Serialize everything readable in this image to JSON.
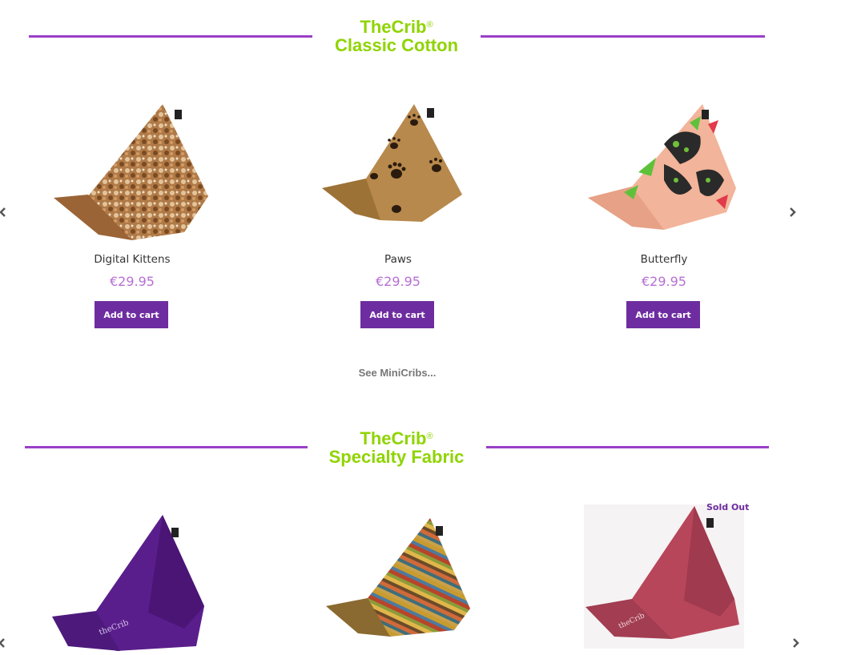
{
  "sections": [
    {
      "brand": "TheCrib",
      "reg_mark": "®",
      "subtitle": "Classic Cotton",
      "products": [
        {
          "name": "Digital Kittens",
          "price": "€29.95",
          "button": "Add to cart",
          "image": "kittens-print-beanbag"
        },
        {
          "name": "Paws",
          "price": "€29.95",
          "button": "Add to cart",
          "image": "paw-print-beanbag"
        },
        {
          "name": "Butterfly",
          "price": "€29.95",
          "button": "Add to cart",
          "image": "butterfly-print-beanbag"
        }
      ]
    },
    {
      "brand": "TheCrib",
      "reg_mark": "®",
      "subtitle": "Specialty Fabric",
      "products": [
        {
          "image": "purple-beanbag"
        },
        {
          "image": "striped-beanbag"
        },
        {
          "image": "red-beanbag",
          "badge": "Sold Out"
        }
      ]
    }
  ],
  "see_more": "See MiniCribs...",
  "colors": {
    "accent_line": "#9b3fc7",
    "heading": "#8fd400",
    "price": "#b76fd4",
    "button": "#6d2da0"
  },
  "icons": {
    "prev": "chevron-left-icon",
    "next": "chevron-right-icon"
  }
}
